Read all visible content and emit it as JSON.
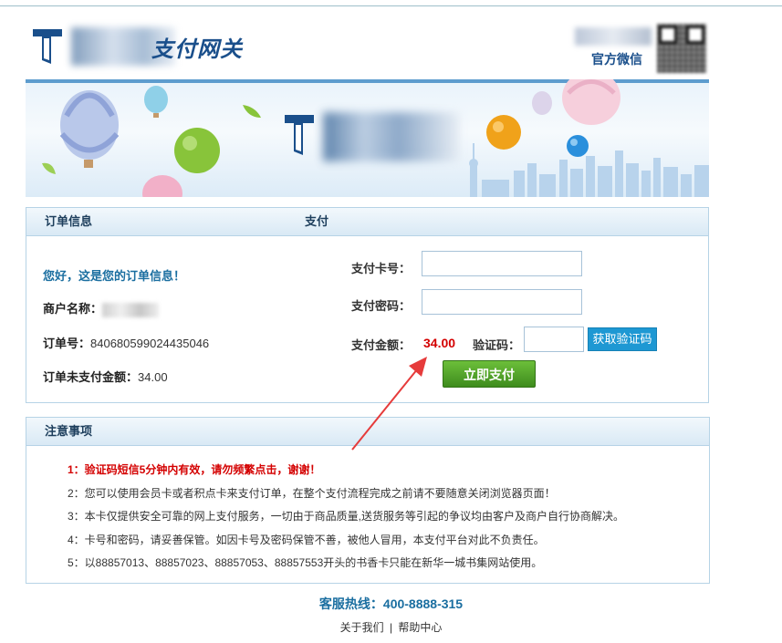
{
  "header": {
    "gateway_title": "支付网关",
    "wechat_label": "官方微信"
  },
  "order_panel": {
    "title": "订单信息",
    "greeting": "您好，这是您的订单信息！",
    "merchant_label": "商户名称：",
    "order_no_label": "订单号：",
    "order_no": "840680599024435046",
    "unpaid_label": "订单未支付金额：",
    "unpaid_amount": "34.00"
  },
  "pay_panel": {
    "title": "支付",
    "card_no_label": "支付卡号：",
    "card_no_value": "",
    "password_label": "支付密码：",
    "password_value": "",
    "amount_label": "支付金额：",
    "amount": "34.00",
    "captcha_label": "验证码：",
    "captcha_value": "",
    "get_code_button": "获取验证码",
    "submit_button": "立即支付"
  },
  "notice_panel": {
    "title": "注意事项",
    "items": [
      "1：验证码短信5分钟内有效，请勿频繁点击，谢谢！",
      "2：您可以使用会员卡或者积点卡来支付订单，在整个支付流程完成之前请不要随意关闭浏览器页面！",
      "3：本卡仅提供安全可靠的网上支付服务，一切由于商品质量,送货服务等引起的争议均由客户及商户自行协商解决。",
      "4：卡号和密码，请妥善保管。如因卡号及密码保管不善，被他人冒用，本支付平台对此不负责任。",
      "5：以88857013、88857023、88857053、88857553开头的书香卡只能在新华一城书集网站使用。"
    ]
  },
  "footer": {
    "hotline": "客服热线：400-8888-315",
    "about_link": "关于我们",
    "separator": "|",
    "help_link": "帮助中心"
  },
  "colors": {
    "brand_blue": "#1a4f8b",
    "link_blue": "#1a6ea0",
    "warning_red": "#d40000",
    "button_blue": "#1e98d3",
    "submit_green": "#4a9d26",
    "annotation_arrow": "#e63b3b"
  }
}
